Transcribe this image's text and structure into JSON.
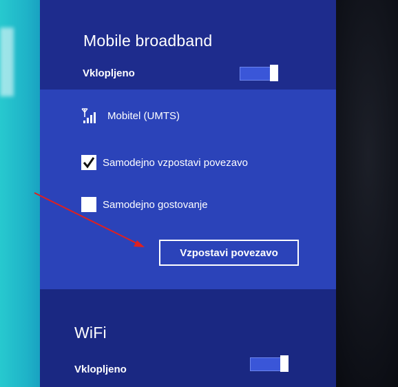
{
  "mobile_broadband": {
    "title": "Mobile broadband",
    "toggle_label": "Vklopljeno",
    "toggle_on": true
  },
  "network": {
    "name": "Mobitel (UMTS)",
    "icon": "signal-strength-icon"
  },
  "options": {
    "auto_connect": {
      "label": "Samodejno vzpostavi povezavo",
      "checked": true
    },
    "auto_roaming": {
      "label": "Samodejno gostovanje",
      "checked": false
    }
  },
  "connect_button": {
    "label": "Vzpostavi povezavo"
  },
  "wifi": {
    "title": "WiFi",
    "toggle_label": "Vklopljeno",
    "toggle_on": true
  },
  "colors": {
    "panel": "#1b2a86",
    "selected": "#2b43b9",
    "annotation_arrow": "#e0201f"
  }
}
